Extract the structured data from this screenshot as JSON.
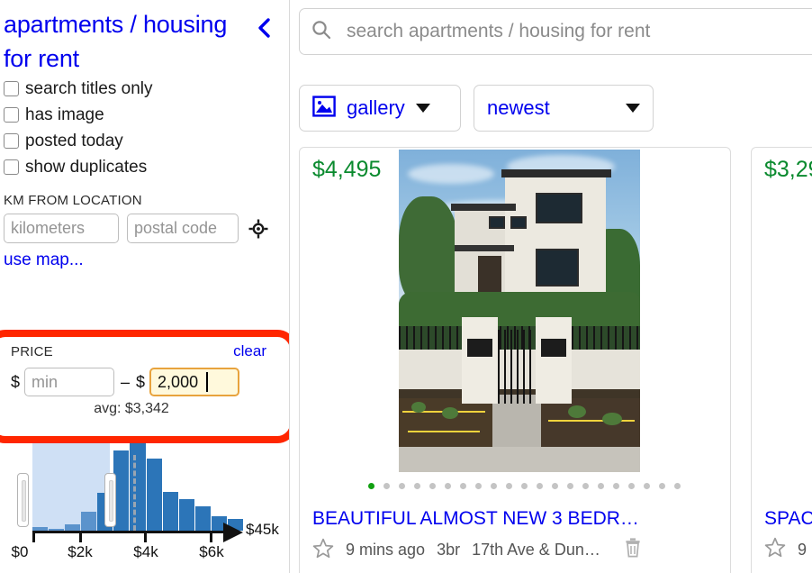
{
  "sidebar": {
    "category_title": "apartments / housing for rent",
    "collapse_icon": "chevron-left-icon",
    "checkboxes": [
      {
        "label": "search titles only",
        "checked": false
      },
      {
        "label": "has image",
        "checked": false
      },
      {
        "label": "posted today",
        "checked": false
      },
      {
        "label": "show duplicates",
        "checked": false
      }
    ],
    "location": {
      "section_title": "KM FROM LOCATION",
      "distance_placeholder": "kilometers",
      "distance_value": "",
      "postal_placeholder": "postal code",
      "postal_value": "",
      "geo_icon": "crosshair-target-icon",
      "use_map_label": "use map..."
    },
    "price": {
      "section_title": "PRICE",
      "clear_label": "clear",
      "currency_symbol": "$",
      "min_placeholder": "min",
      "min_value": "",
      "separator": "–",
      "max_value": "2,000",
      "avg_label": "avg: $3,342",
      "highlight_color": "#FF2600",
      "focus_border_color": "#E8A33D",
      "focus_background_color": "#FFF9DC"
    }
  },
  "histogram": {
    "axis_end_label": "$45k",
    "tick_labels": [
      "$0",
      "$2k",
      "$4k",
      "$6k"
    ],
    "selection_from": "$0",
    "selection_to": "$2,000",
    "avg_marker": "$3,342"
  },
  "chart_data": {
    "type": "bar",
    "title": "",
    "xlabel": "",
    "ylabel": "",
    "categories": [
      "0-500",
      "500-1000",
      "1000-1500",
      "1500-2000",
      "2000-2500",
      "2500-3000",
      "3000-3500",
      "3500-4000",
      "4000-4500",
      "4500-5000",
      "5000-5500",
      "5500-6000",
      "6000-6500"
    ],
    "values": [
      4,
      2,
      7,
      22,
      43,
      92,
      100,
      82,
      44,
      36,
      28,
      16,
      13
    ],
    "ylim": [
      0,
      100
    ],
    "xlim": [
      0,
      6500
    ],
    "grid": false,
    "legend": null,
    "selected_range": [
      0,
      2000
    ],
    "selected_indices": [
      0,
      1,
      2,
      3
    ],
    "tick_values": [
      0,
      2000,
      4000,
      6000
    ],
    "tick_labels": [
      "$0",
      "$2k",
      "$4k",
      "$6k"
    ],
    "axis_overflow_label": "$45k",
    "avg_line_value": 3342,
    "bar_color": "#2C75B8",
    "selected_bar_color": "#5B93CC",
    "selection_band_color": "#CFE0F5"
  },
  "main": {
    "search": {
      "icon": "search-icon",
      "placeholder": "search apartments / housing for rent",
      "value": ""
    },
    "toolbar": {
      "view_icon": "image-gallery-icon",
      "view_label": "gallery",
      "sort_label": "newest",
      "caret_icon": "caret-down-icon"
    },
    "listings": [
      {
        "price": "$4,495",
        "title": "BEAUTIFUL ALMOST NEW 3 BEDR…",
        "posted": "9 mins ago",
        "bedrooms": "3br",
        "location": "17th Ave & Dun…",
        "favorite_icon": "star-outline-icon",
        "hide_icon": "trash-icon",
        "photo_count": 21,
        "active_photo": 1
      },
      {
        "price": "$3,29",
        "title": "SPAC",
        "posted": "9",
        "bedrooms": "",
        "location": "",
        "favorite_icon": "star-outline-icon",
        "hide_icon": "trash-icon",
        "photo_count": 0,
        "active_photo": 1
      }
    ]
  },
  "colors": {
    "link": "#0000EE",
    "price_green": "#0A8A2E",
    "highlight_red": "#FF2600",
    "active_dot": "#11A011"
  }
}
